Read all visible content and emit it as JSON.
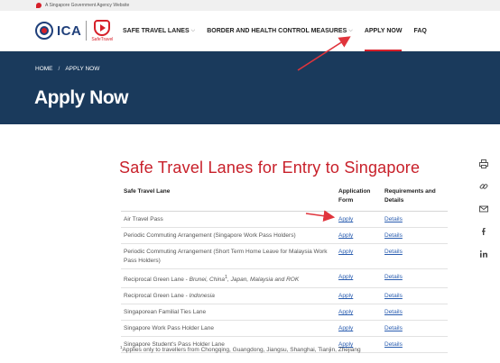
{
  "masthead": {
    "text": "A Singapore Government Agency Website"
  },
  "logos": {
    "ica": "ICA",
    "safe_travel": "SafeTravel"
  },
  "nav": {
    "items": [
      {
        "label": "SAFE TRAVEL LANES",
        "has_dropdown": true
      },
      {
        "label": "BORDER AND HEALTH CONTROL MEASURES",
        "has_dropdown": true
      },
      {
        "label": "APPLY NOW",
        "has_dropdown": false,
        "active": true
      },
      {
        "label": "FAQ",
        "has_dropdown": false
      }
    ],
    "chevron": "⌵"
  },
  "breadcrumb": {
    "home": "HOME",
    "separator": "/",
    "current": "APPLY NOW"
  },
  "page_title": "Apply Now",
  "section_title": "Safe Travel Lanes for Entry to Singapore",
  "table": {
    "headers": [
      "Safe Travel Lane",
      "Application Form",
      "Requirements and Details"
    ],
    "rows": [
      {
        "lane": "Air Travel Pass",
        "apply": "Apply",
        "details": "Details"
      },
      {
        "lane": "Periodic Commuting Arrangement (Singapore Work Pass Holders)",
        "apply": "Apply",
        "details": "Details"
      },
      {
        "lane": "Periodic Commuting Arrangement (Short Term Home Leave for Malaysia Work Pass Holders)",
        "apply": "Apply",
        "details": "Details"
      },
      {
        "lane_prefix": "Reciprocal Green Lane - ",
        "lane_italic": "Brunei, China",
        "lane_sup": "1",
        "lane_italic2": ", Japan, Malaysia and ROK",
        "apply": "Apply",
        "details": "Details"
      },
      {
        "lane_prefix": "Reciprocal Green Lane - ",
        "lane_italic": "Indonesia",
        "apply": "Apply",
        "details": "Details"
      },
      {
        "lane": "Singaporean Familial Ties Lane",
        "apply": "Apply",
        "details": "Details"
      },
      {
        "lane": "Singapore Work Pass Holder Lane",
        "apply": "Apply",
        "details": "Details"
      },
      {
        "lane": "Singapore Student's Pass Holder Lane",
        "apply": "Apply",
        "details": "Details"
      }
    ]
  },
  "footnote": {
    "sup": "1",
    "text": "Applies only to travellers from Chongqing, Guangdong, Jiangsu, Shanghai, Tianjin, Zhejiang"
  },
  "share": [
    {
      "icon": "print-icon",
      "glyph": "⎙"
    },
    {
      "icon": "link-icon",
      "glyph": "🔗"
    },
    {
      "icon": "email-icon",
      "glyph": "✉"
    },
    {
      "icon": "facebook-icon",
      "glyph": "f"
    },
    {
      "icon": "linkedin-icon",
      "glyph": "in"
    }
  ],
  "colors": {
    "accent_red": "#d6202a",
    "hero_bg": "#1a3a5c",
    "link_blue": "#2a5db0",
    "annotation_red": "#e0343c"
  }
}
